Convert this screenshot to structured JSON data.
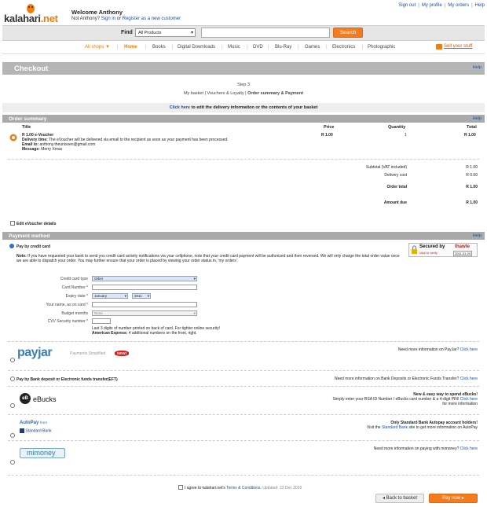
{
  "header": {
    "logo_text": "kalahari",
    "logo_suffix": ".net",
    "welcome": "Welcome Anthony",
    "not_you": "Not Anthony?",
    "sign_in": "Sign in",
    "or": "or",
    "register": "Register as a new customer",
    "top_links": [
      "Sign out",
      "My profile",
      "My orders",
      "Help"
    ]
  },
  "search": {
    "find_label": "Find",
    "category": "All Products",
    "query": "",
    "button": "Search"
  },
  "nav": {
    "all_shops": "All shops ▼",
    "items": [
      "Home",
      "Books",
      "Digital Downloads",
      "Music",
      "DVD",
      "Blu-Ray",
      "Games",
      "Electronics",
      "Photographic"
    ],
    "sell": "Sell your stuff"
  },
  "checkout": {
    "title": "Checkout",
    "help": "Help",
    "step": "Step 3",
    "crumb_1": "My basket",
    "crumb_2": "Vouchers & Loyalty",
    "crumb_3": "Order summary & Payment",
    "click_here": "Click here",
    "click_rest": "to edit the delivery information or the contents of your basket"
  },
  "order_summary": {
    "title": "Order summary",
    "help": "Help",
    "columns": [
      "Title",
      "Price",
      "Quantity",
      "Total"
    ],
    "item": {
      "name": "R 1.00 e-Voucher",
      "delivery_label": "Delivery time:",
      "delivery": "The eVoucher will be delivered via email to the recipient as soon as your payment has been processed.",
      "email_label": "Email to:",
      "email": "anthony.theunissen@gmail.com",
      "message_label": "Message:",
      "message": "Merry Xmas",
      "price": "R 1.00",
      "quantity": "1",
      "total": "R 1.00"
    },
    "subtotal_label": "Subtotal (VAT included)",
    "subtotal": "R 1.00",
    "delivery_label": "Delivery cost",
    "delivery_cost": "R 0.00",
    "order_total_label": "Order total",
    "order_total": "R 1.00",
    "amount_due_label": "Amount due",
    "amount_due": "R 1.00",
    "edit_details": "Edit eVoucher details"
  },
  "payment": {
    "title": "Payment method",
    "help": "Help",
    "credit_card_label": "Pay by credit card",
    "secured_by": "Secured by",
    "thawte": "thawte",
    "click_verify": "click to verify",
    "secured_date": "2011-01-24",
    "note_label": "Note:",
    "note": "If you have requested your bank to send you credit card activity notifications via your cellphone, note that your credit card payment will be authorized and then reversed. We will only charge the total order value once we are able to dispatch your order. You may further ensure that your order is placed by viewing your order status in, 'my orders'.",
    "fields": {
      "card_type_label": "Credit card type",
      "card_type": "Other",
      "card_number_label": "Card Number",
      "expiry_label": "Expiry date",
      "expiry_month": "January",
      "expiry_year": "2011",
      "name_label": "Your name, as on card",
      "budget_label": "Budget months",
      "budget": "None",
      "cvv_label": "CVV Security number",
      "cvv_hint": "Last 3 digits of number printed on back of card. For tighter online security!",
      "amex_label": "American Express:",
      "amex_hint": "4 additional numbers on the front, right."
    },
    "payjar_logo": "payjar",
    "payjar_tag": "Payments Simplified",
    "payjar_new": "NEW!",
    "payjar_info": "Need more information on PayJar?",
    "click_here": "Click here",
    "eft_label": "Pay by Bank deposit or Electronic funds transfer(EFT)",
    "eft_info": "Need more information on Bank Deposits or Electronic Funds Transfer?",
    "ebucks_logo_mark": "eB",
    "ebucks_logo": "eBucks",
    "ebucks_title": "New & easy way to spend eBucks!",
    "ebucks_info": "Simply enter your RSA ID Number / eBucks card number & a 4-digit PIN!",
    "ebucks_info2": "for more information",
    "autopay_logo": "AutoPay",
    "autopay_from": "from",
    "standard_bank": "Standard Bank",
    "autopay_title": "Only Standard Bank Autopay account holders!",
    "autopay_visit": "Visit the",
    "autopay_site": "Standard Bank",
    "autopay_rest": "site to get more information on AutoPay",
    "mimoney_logo": "mimoney",
    "mimoney_info": "Need more information on paying with mimoney?"
  },
  "footer": {
    "agree": "I agree to kalahari.net's",
    "terms": "Terms & Conditions",
    "updated": "Updated: 23 Dec 2010",
    "back": "Back to basket",
    "pay": "Pay now"
  },
  "colors": {
    "accent": "#f47c1f",
    "link": "#1f4fa8",
    "bar": "#a9a9a9"
  }
}
